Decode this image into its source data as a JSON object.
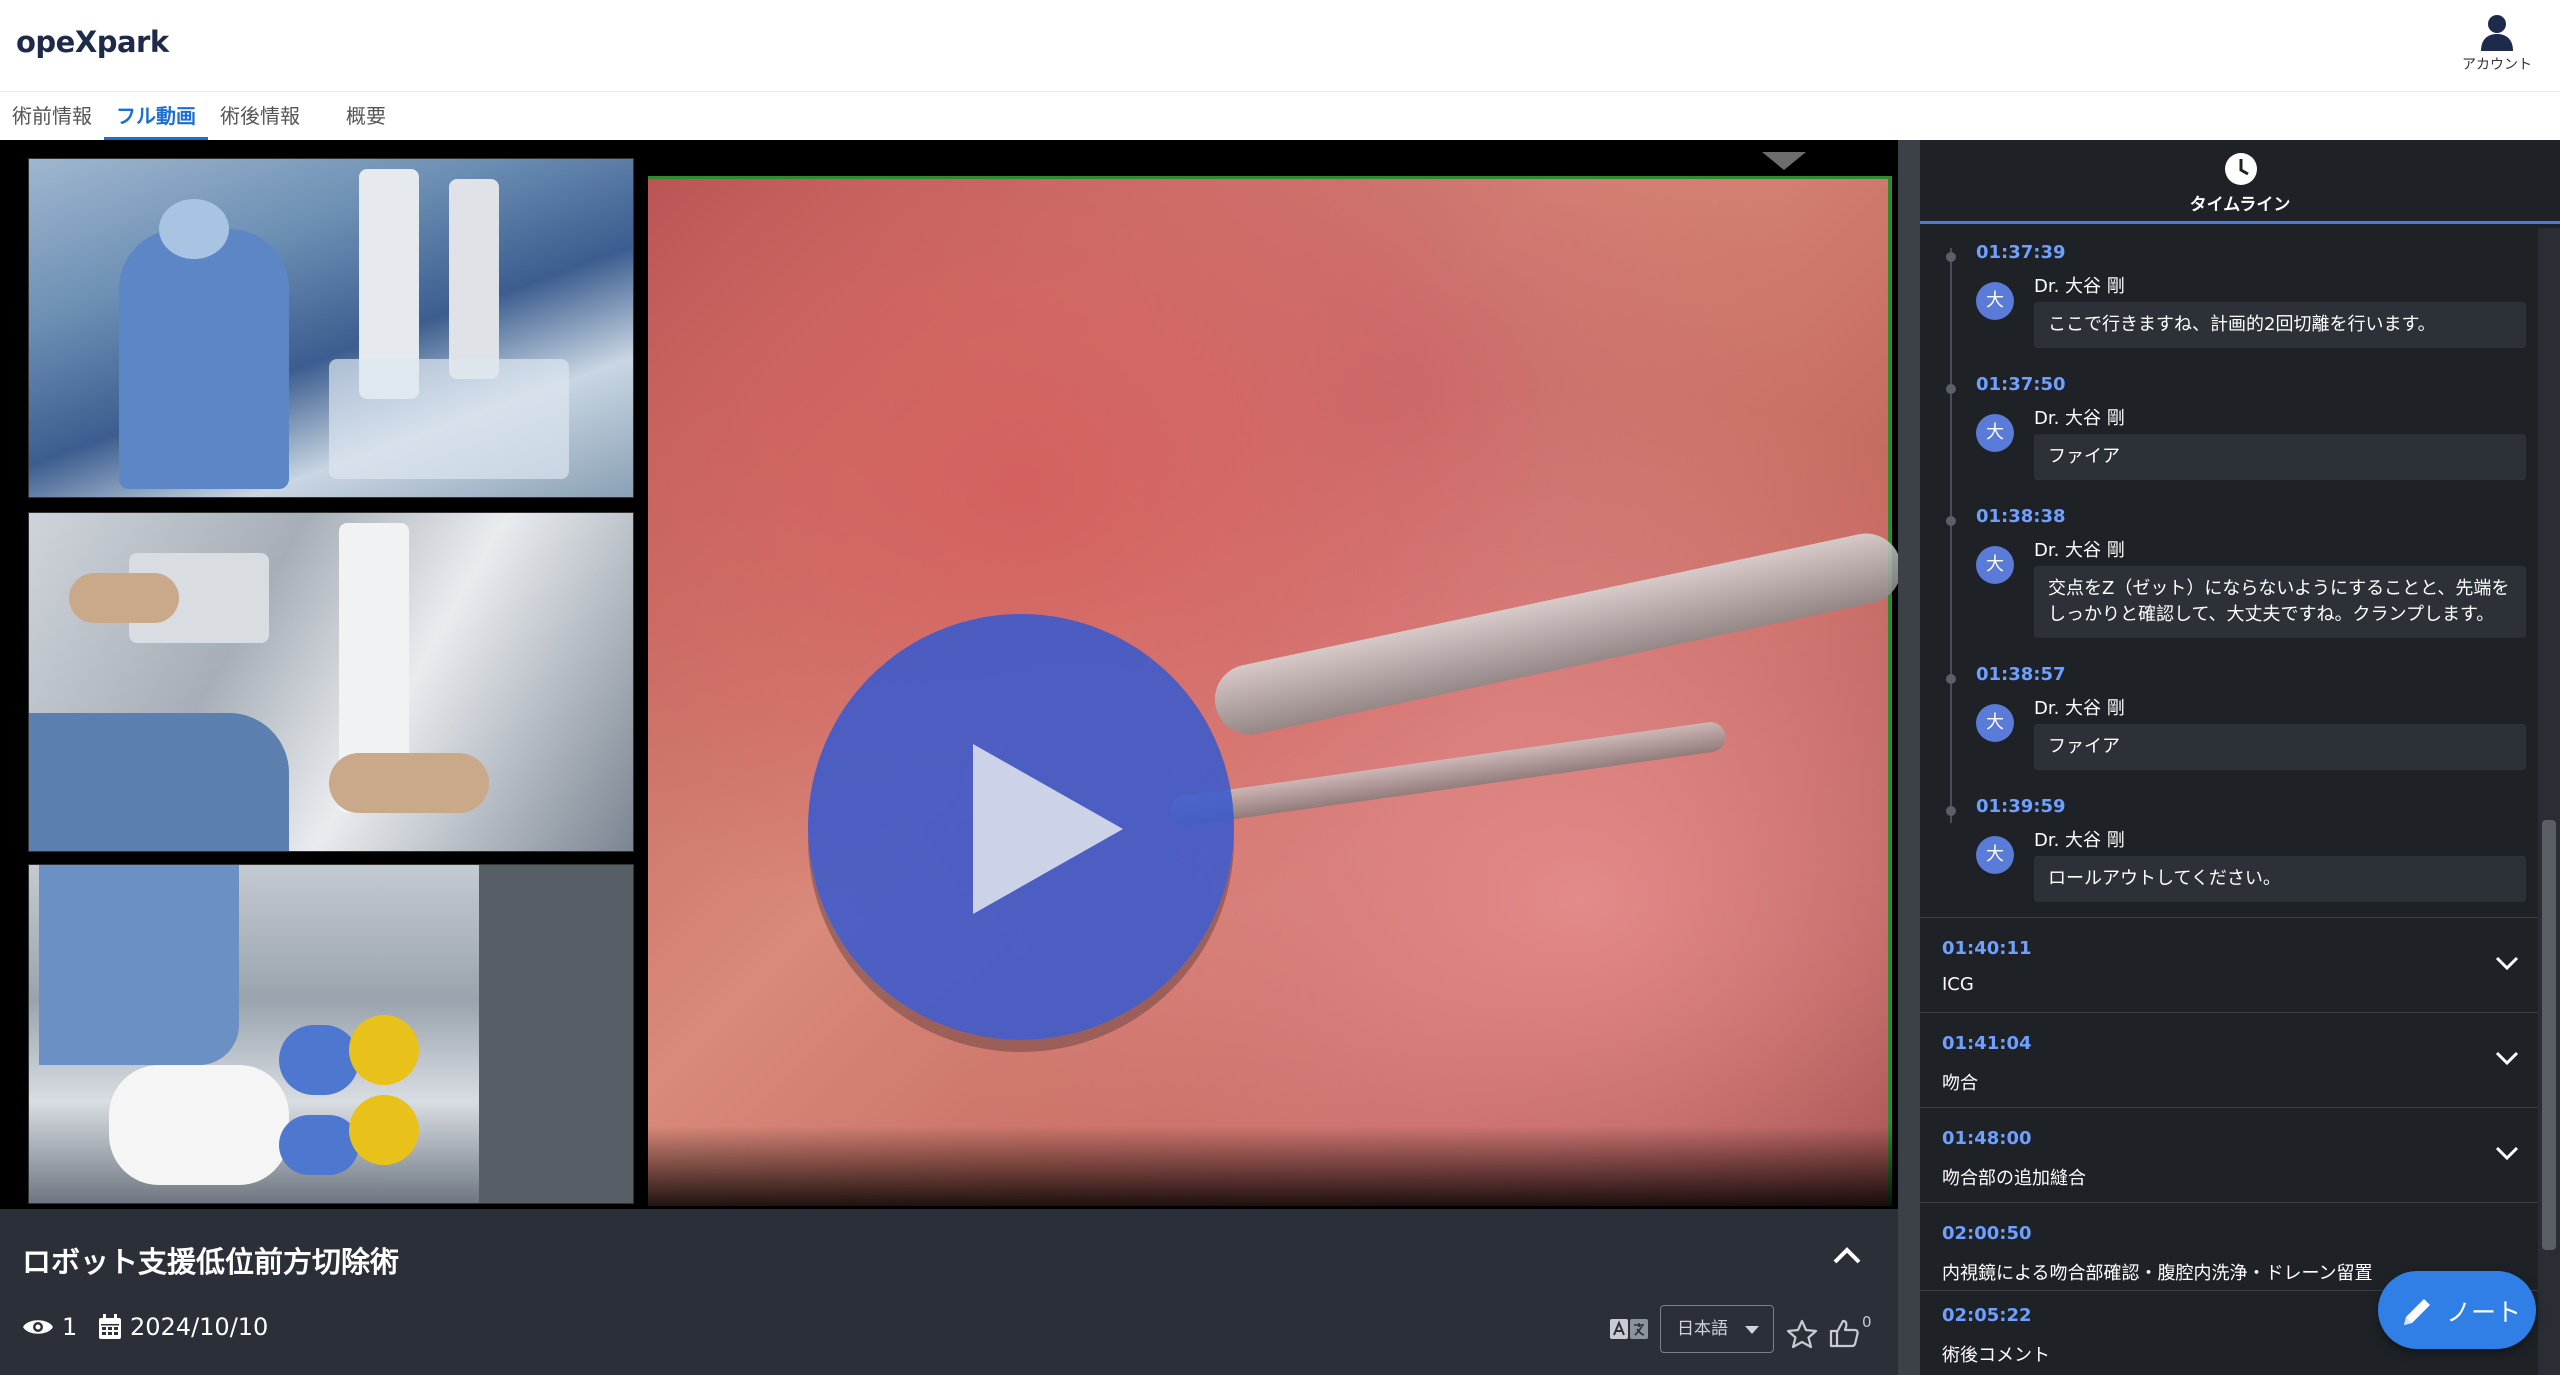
{
  "app": {
    "logo": "opeXpark"
  },
  "header": {
    "account_label": "アカウント"
  },
  "tabs": [
    {
      "label": "術前情報",
      "active": false
    },
    {
      "label": "フル動画",
      "active": true
    },
    {
      "label": "術後情報",
      "active": false
    },
    {
      "label": "概要",
      "active": false
    }
  ],
  "video": {
    "title": "ロボット支援低位前方切除術",
    "views": "1",
    "date": "2024/10/10",
    "language": "日本語",
    "likes": "0",
    "accent_color": "#3a5acd"
  },
  "timeline": {
    "header_label": "タイムライン",
    "comments": [
      {
        "time": "01:37:39",
        "avatar": "大",
        "author": "Dr. 大谷 剛",
        "text": "ここで行きますね、計画的2回切離を行います。"
      },
      {
        "time": "01:37:50",
        "avatar": "大",
        "author": "Dr. 大谷 剛",
        "text": "ファイア"
      },
      {
        "time": "01:38:38",
        "avatar": "大",
        "author": "Dr. 大谷 剛",
        "text": "交点をZ（ゼット）にならないようにすることと、先端をしっかりと確認して、大丈夫ですね。クランプします。"
      },
      {
        "time": "01:38:57",
        "avatar": "大",
        "author": "Dr. 大谷 剛",
        "text": "ファイア"
      },
      {
        "time": "01:39:59",
        "avatar": "大",
        "author": "Dr. 大谷 剛",
        "text": "ロールアウトしてください。"
      }
    ],
    "sections": [
      {
        "time": "01:40:11",
        "label": "ICG"
      },
      {
        "time": "01:41:04",
        "label": "吻合"
      },
      {
        "time": "01:48:00",
        "label": "吻合部の追加縫合"
      },
      {
        "time": "02:00:50",
        "label": "内視鏡による吻合部確認・腹腔内洗浄・ドレーン留置"
      },
      {
        "time": "02:05:22",
        "label": "術後コメント"
      }
    ]
  },
  "note_button": {
    "label": "ノート"
  }
}
